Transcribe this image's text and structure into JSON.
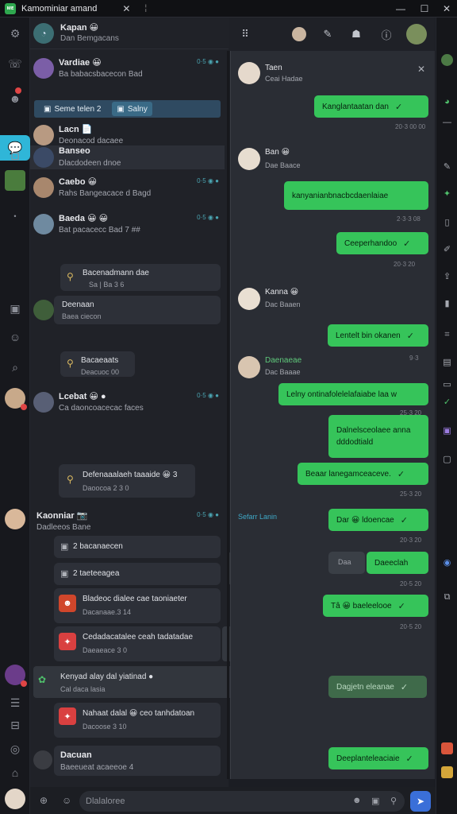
{
  "window": {
    "app_badge": "ᴍᴇ",
    "title": "Kamominiar amand",
    "tab_close": "✕",
    "separator": "¦",
    "minimize": "—",
    "maximize": "☐",
    "close": "✕"
  },
  "header": {
    "name": "Kapan 😀",
    "sub": "Dan Bemgacans"
  },
  "filters": [
    {
      "label": "Seme telen 2",
      "icon": "▣"
    },
    {
      "label": "Salny",
      "icon": "▣"
    }
  ],
  "chats": [
    {
      "name": "Vardiae 😀",
      "preview": "Ba babacsbacecon Bad",
      "meta": "0·5 ◉ ●"
    },
    {
      "name": "Lacn 📄",
      "preview": "Deonacod dacaee"
    },
    {
      "name": "Banseo",
      "preview": "Dlacdodeen dnoe"
    },
    {
      "name": "Caebo 😀",
      "preview": "Rahs Bangeacace d Bagd",
      "meta": "0·5 ◉ ●"
    },
    {
      "name": "Baeda 😀 😀",
      "preview": "Bat pacacecc Bad 7 ##",
      "meta": "0·5 ◉ ●"
    },
    {
      "name": "Lcebat 😀 ●",
      "preview": "Ca daoncoacecac faces",
      "meta": "0·5 ◉ ●"
    },
    {
      "name": "Kaonniar 📷",
      "preview": "Dadleeos Bane",
      "meta": "0·5 ◉ ●"
    },
    {
      "name": "Dacuan",
      "preview": "Baeeueat acaeeoe 4"
    }
  ],
  "list_bubbles": [
    {
      "title": "Bacenadmann dae",
      "sub": "Sa | Ba 3 6"
    },
    {
      "title": "Deenaan",
      "sub": "Baea ciecon"
    },
    {
      "title": "Bacaeaats",
      "sub": "Deacuoc 00"
    },
    {
      "title": "Defenaaalaeh taaaide 😀 3",
      "sub": "Daoocoa 2 3 0"
    },
    {
      "title": "2 bacanaecen",
      "sub": ""
    },
    {
      "title": "2 taeteeagea",
      "sub": ""
    },
    {
      "title": "Bladeoc dialee cae taoniaeter",
      "sub": "Dacanaae.3 14"
    },
    {
      "title": "Cedadacatalee ceah tadatadae",
      "sub": "Daeaeace 3 0"
    },
    {
      "title": "Kenyad alay dal yiatinad ●",
      "sub": "Cal daca lasia"
    },
    {
      "title": "Nahaat dalal 😀 ceo tanhdatoan",
      "sub": "Dacoose 3 10"
    }
  ],
  "conversation": {
    "contact": {
      "name": "Taen",
      "sub": "Ceai Hadae"
    },
    "cards": [
      {
        "name": "Ban 😀",
        "sub": "Dae Baace"
      },
      {
        "name": "Kanna 😀",
        "sub": "Dac Baaen"
      },
      {
        "name": "Daenaeae",
        "sub": "Dac Baaae"
      }
    ],
    "forward_label": "Sefarr Lanin",
    "outgoing": [
      {
        "text": "Kanglantaatan dan",
        "time": "20·3 00 00"
      },
      {
        "text": "kanyanianbnacbcdaenlaiae",
        "time": "2·3·3 08"
      },
      {
        "text": "Ceeperhandoo",
        "time": "20·3 20"
      },
      {
        "text": "Lentelt bin okanen",
        "time": "9·3"
      },
      {
        "text": "Lelny ontinafolelelafaiabe laa w",
        "time": "25·3 20"
      },
      {
        "text": "Dalnelsceolaee anna dddodtiald",
        "time": ""
      },
      {
        "text": "Beaar lanegamceaceve.",
        "time": "25·3 20"
      },
      {
        "text": "Dar 😀 ldoencae",
        "time": "20·3 20"
      },
      {
        "text": "Daeeclah",
        "time": "20·5 20"
      },
      {
        "text": "Tâ 😀 baeleelooe",
        "time": "20·5 20"
      },
      {
        "text": "Dagjetn eleanae",
        "time": ""
      },
      {
        "text": "Deeplanteleaciaie",
        "time": ""
      }
    ],
    "ghost_label": "Daa"
  },
  "composer": {
    "placeholder": "Dlalaloree",
    "send_icon": "send-icon"
  }
}
